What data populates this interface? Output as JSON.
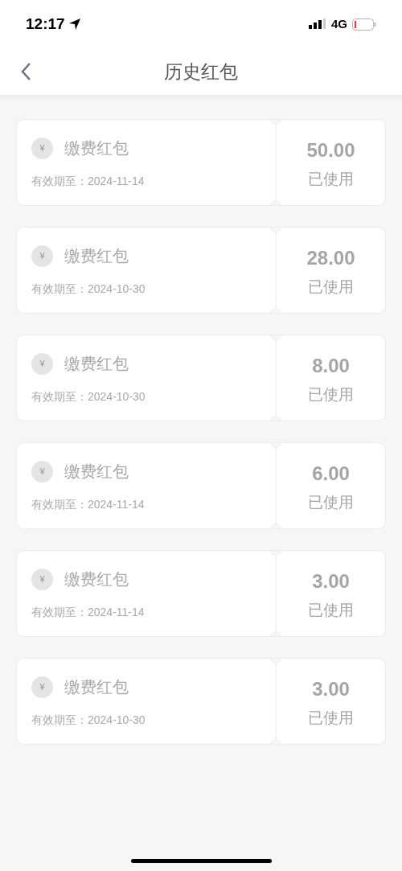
{
  "status_bar": {
    "time": "12:17",
    "network": "4G"
  },
  "nav": {
    "title": "历史红包"
  },
  "coupons": [
    {
      "coin": "¥",
      "name": "缴费红包",
      "expiry": "有效期至：2024-11-14",
      "amount": "50.00",
      "status": "已使用"
    },
    {
      "coin": "¥",
      "name": "缴费红包",
      "expiry": "有效期至：2024-10-30",
      "amount": "28.00",
      "status": "已使用"
    },
    {
      "coin": "¥",
      "name": "缴费红包",
      "expiry": "有效期至：2024-10-30",
      "amount": "8.00",
      "status": "已使用"
    },
    {
      "coin": "¥",
      "name": "缴费红包",
      "expiry": "有效期至：2024-11-14",
      "amount": "6.00",
      "status": "已使用"
    },
    {
      "coin": "¥",
      "name": "缴费红包",
      "expiry": "有效期至：2024-11-14",
      "amount": "3.00",
      "status": "已使用"
    },
    {
      "coin": "¥",
      "name": "缴费红包",
      "expiry": "有效期至：2024-10-30",
      "amount": "3.00",
      "status": "已使用"
    }
  ]
}
